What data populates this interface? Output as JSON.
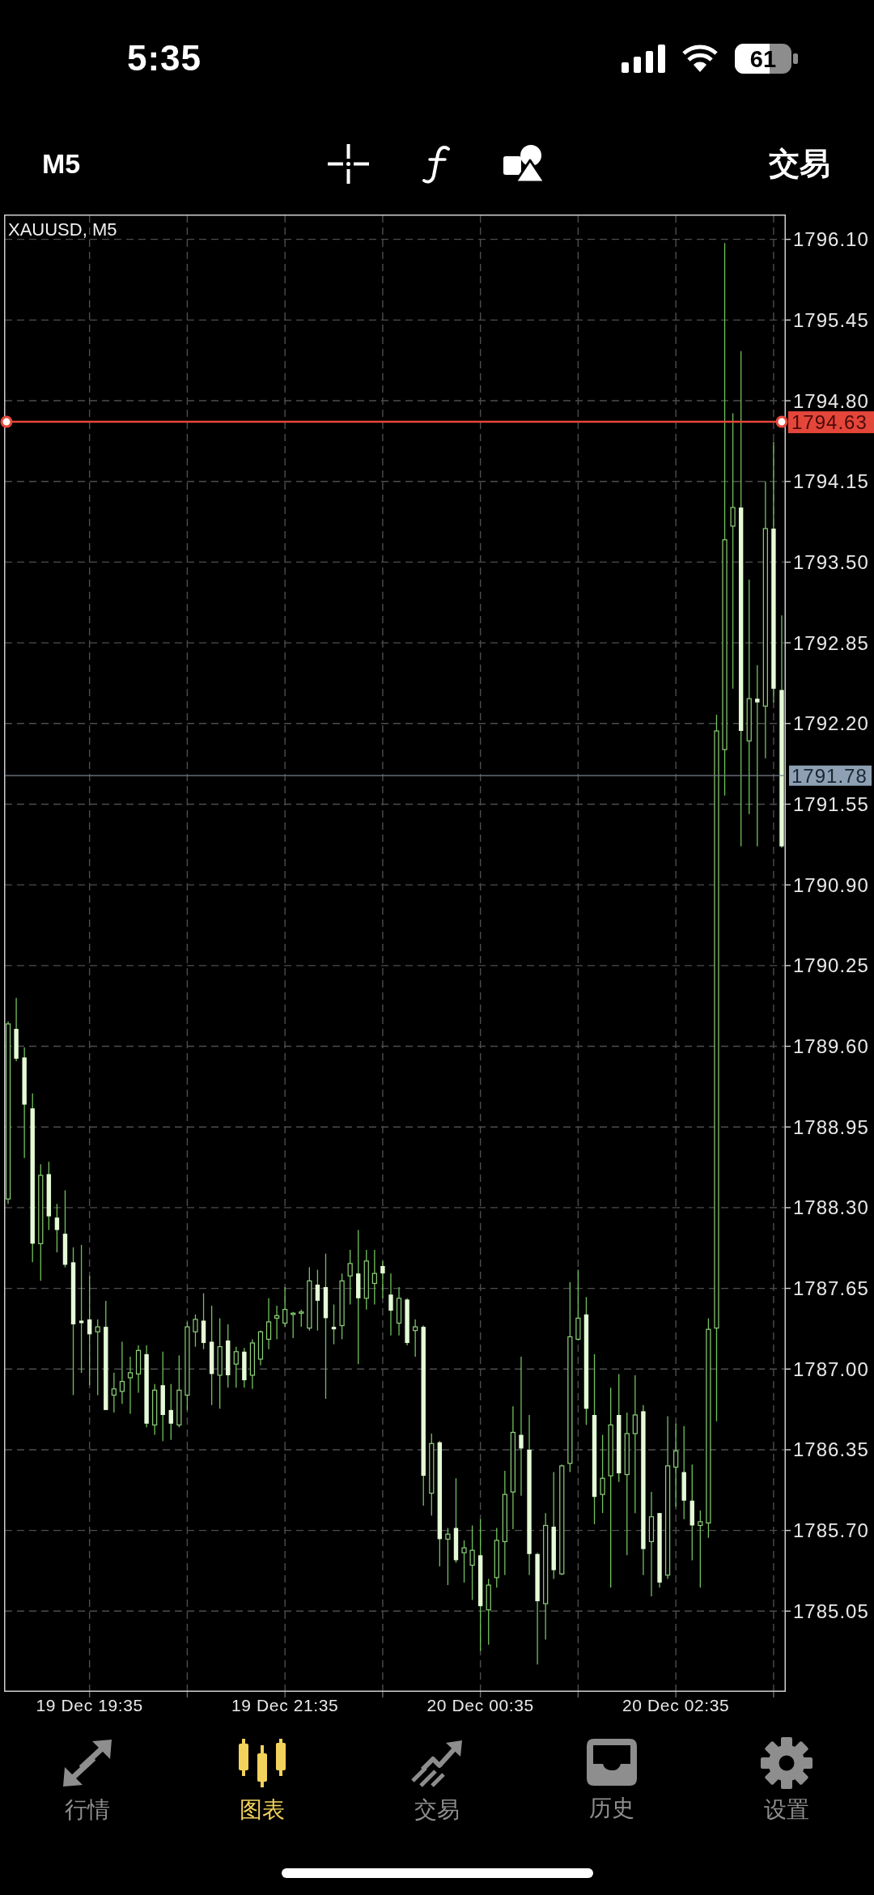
{
  "status_bar": {
    "time": "5:35",
    "battery": "61"
  },
  "toolbar": {
    "timeframe": "M5",
    "trade": "交易"
  },
  "chart": {
    "chart_data": {
      "type": "candlestick",
      "title": "XAUUSD, M5",
      "grid": true,
      "categories": [
        null,
        null,
        null,
        null,
        null,
        null,
        null,
        null,
        null,
        null,
        "19 Dec 19:35",
        null,
        null,
        null,
        null,
        null,
        null,
        null,
        null,
        null,
        null,
        null,
        null,
        null,
        null,
        null,
        null,
        null,
        null,
        null,
        null,
        null,
        null,
        null,
        "19 Dec 21:35",
        null,
        null,
        null,
        null,
        null,
        null,
        null,
        null,
        null,
        null,
        null,
        null,
        null,
        null,
        null,
        null,
        null,
        null,
        null,
        null,
        null,
        null,
        null,
        "20 Dec 00:35",
        null,
        null,
        null,
        null,
        null,
        null,
        null,
        null,
        null,
        null,
        null,
        null,
        null,
        null,
        null,
        null,
        null,
        null,
        null,
        null,
        null,
        null,
        null,
        "20 Dec 02:35",
        null,
        null,
        null,
        null,
        null,
        null,
        null,
        null,
        null,
        null,
        null,
        null,
        null
      ],
      "ohlc": [
        [
          1788.37,
          1789.8,
          1788.33,
          1789.78
        ],
        [
          1789.74,
          1789.99,
          1789.48,
          1789.5
        ],
        [
          1789.51,
          1789.59,
          1788.7,
          1789.13
        ],
        [
          1789.1,
          1789.22,
          1787.86,
          1788.01
        ],
        [
          1788.01,
          1788.65,
          1787.71,
          1788.56
        ],
        [
          1788.57,
          1788.67,
          1788.12,
          1788.23
        ],
        [
          1788.22,
          1788.33,
          1787.94,
          1788.12
        ],
        [
          1788.09,
          1788.44,
          1787.82,
          1787.84
        ],
        [
          1787.86,
          1787.98,
          1786.79,
          1787.36
        ],
        [
          1787.39,
          1788.0,
          1786.97,
          1787.37
        ],
        [
          1787.4,
          1787.75,
          1786.87,
          1787.28
        ],
        [
          1787.3,
          1787.4,
          1786.79,
          1787.34
        ],
        [
          1787.34,
          1787.55,
          1786.67,
          1786.67
        ],
        [
          1786.79,
          1786.97,
          1786.65,
          1786.84
        ],
        [
          1786.82,
          1787.22,
          1786.72,
          1786.9
        ],
        [
          1786.93,
          1787.1,
          1786.64,
          1786.97
        ],
        [
          1786.96,
          1787.19,
          1786.81,
          1787.15
        ],
        [
          1787.12,
          1787.19,
          1786.53,
          1786.56
        ],
        [
          1786.55,
          1786.88,
          1786.47,
          1786.83
        ],
        [
          1786.87,
          1787.14,
          1786.42,
          1786.63
        ],
        [
          1786.67,
          1786.88,
          1786.43,
          1786.56
        ],
        [
          1786.55,
          1787.11,
          1786.53,
          1786.83
        ],
        [
          1786.79,
          1787.38,
          1786.67,
          1787.34
        ],
        [
          1787.3,
          1787.44,
          1787.18,
          1787.4
        ],
        [
          1787.39,
          1787.61,
          1787.16,
          1787.21
        ],
        [
          1787.22,
          1787.51,
          1786.71,
          1786.96
        ],
        [
          1786.95,
          1787.41,
          1786.68,
          1787.18
        ],
        [
          1787.23,
          1787.36,
          1786.85,
          1786.95
        ],
        [
          1787.04,
          1787.18,
          1786.85,
          1787.14
        ],
        [
          1787.14,
          1787.17,
          1786.85,
          1786.91
        ],
        [
          1786.95,
          1787.24,
          1786.84,
          1787.21
        ],
        [
          1787.08,
          1787.31,
          1787.03,
          1787.3
        ],
        [
          1787.24,
          1787.57,
          1787.16,
          1787.38
        ],
        [
          1787.41,
          1787.51,
          1787.24,
          1787.43
        ],
        [
          1787.37,
          1787.66,
          1787.34,
          1787.48
        ],
        [
          1787.44,
          1787.46,
          1787.25,
          1787.45
        ],
        [
          1787.45,
          1787.48,
          1787.34,
          1787.46
        ],
        [
          1787.33,
          1787.82,
          1787.31,
          1787.71
        ],
        [
          1787.68,
          1787.8,
          1787.31,
          1787.55
        ],
        [
          1787.66,
          1787.93,
          1786.76,
          1787.41
        ],
        [
          1787.34,
          1787.52,
          1787.2,
          1787.32
        ],
        [
          1787.35,
          1787.77,
          1787.24,
          1787.71
        ],
        [
          1787.75,
          1787.96,
          1787.52,
          1787.85
        ],
        [
          1787.77,
          1788.12,
          1787.04,
          1787.57
        ],
        [
          1787.57,
          1787.96,
          1787.48,
          1787.87
        ],
        [
          1787.69,
          1787.96,
          1787.52,
          1787.77
        ],
        [
          1787.83,
          1787.87,
          1787.57,
          1787.77
        ],
        [
          1787.6,
          1787.77,
          1787.27,
          1787.47
        ],
        [
          1787.37,
          1787.66,
          1787.27,
          1787.57
        ],
        [
          1787.56,
          1787.57,
          1787.19,
          1787.21
        ],
        [
          1787.31,
          1787.4,
          1787.1,
          1787.34
        ],
        [
          1787.34,
          1787.35,
          1785.9,
          1786.14
        ],
        [
          1786.0,
          1786.48,
          1785.82,
          1786.4
        ],
        [
          1786.41,
          1786.42,
          1785.41,
          1785.63
        ],
        [
          1785.63,
          1785.72,
          1785.26,
          1785.67
        ],
        [
          1785.72,
          1786.12,
          1785.44,
          1785.46
        ],
        [
          1785.52,
          1785.62,
          1785.28,
          1785.56
        ],
        [
          1785.42,
          1785.74,
          1785.14,
          1785.54
        ],
        [
          1785.5,
          1785.79,
          1784.73,
          1785.09
        ],
        [
          1785.06,
          1785.31,
          1784.78,
          1785.26
        ],
        [
          1785.32,
          1785.72,
          1785.24,
          1785.62
        ],
        [
          1785.61,
          1786.18,
          1785.34,
          1785.99
        ],
        [
          1786.01,
          1786.7,
          1785.71,
          1786.49
        ],
        [
          1786.47,
          1787.1,
          1785.98,
          1786.36
        ],
        [
          1786.35,
          1786.63,
          1785.34,
          1785.51
        ],
        [
          1785.51,
          1785.52,
          1784.62,
          1785.13
        ],
        [
          1785.11,
          1785.84,
          1784.82,
          1785.74
        ],
        [
          1785.73,
          1786.17,
          1785.31,
          1785.38
        ],
        [
          1785.35,
          1786.23,
          1785.34,
          1786.22
        ],
        [
          1786.24,
          1787.7,
          1786.17,
          1787.26
        ],
        [
          1787.24,
          1787.8,
          1787.23,
          1787.41
        ],
        [
          1787.44,
          1787.58,
          1786.55,
          1786.68
        ],
        [
          1786.63,
          1787.12,
          1785.75,
          1785.97
        ],
        [
          1785.99,
          1786.47,
          1785.84,
          1786.12
        ],
        [
          1786.14,
          1786.85,
          1785.24,
          1786.55
        ],
        [
          1786.63,
          1786.96,
          1786.09,
          1786.16
        ],
        [
          1786.15,
          1786.65,
          1785.5,
          1786.48
        ],
        [
          1786.48,
          1786.95,
          1785.84,
          1786.63
        ],
        [
          1786.66,
          1786.71,
          1785.34,
          1785.55
        ],
        [
          1785.61,
          1786.01,
          1785.17,
          1785.81
        ],
        [
          1785.84,
          1785.84,
          1785.24,
          1785.28
        ],
        [
          1785.34,
          1786.62,
          1785.31,
          1786.22
        ],
        [
          1786.21,
          1786.56,
          1785.89,
          1786.34
        ],
        [
          1786.17,
          1786.54,
          1785.79,
          1785.94
        ],
        [
          1785.94,
          1786.23,
          1785.46,
          1785.74
        ],
        [
          1785.74,
          1785.86,
          1785.24,
          1785.77
        ],
        [
          1785.76,
          1787.41,
          1785.64,
          1787.32
        ],
        [
          1787.33,
          1792.27,
          1786.58,
          1792.14
        ],
        [
          1791.99,
          1796.07,
          1791.62,
          1793.68
        ],
        [
          1793.79,
          1794.7,
          1792.48,
          1793.94
        ],
        [
          1793.94,
          1795.2,
          1791.21,
          1792.14
        ],
        [
          1792.06,
          1793.36,
          1791.47,
          1792.4
        ],
        [
          1792.4,
          1792.67,
          1791.21,
          1792.37
        ],
        [
          1792.34,
          1794.15,
          1791.92,
          1793.77
        ],
        [
          1793.77,
          1794.47,
          1792.37,
          1792.48
        ],
        [
          1792.47,
          1793.07,
          1791.2,
          1791.21
        ]
      ],
      "ylim": [
        1784.4,
        1796.3
      ],
      "yticks": [
        {
          "value": 1796.1,
          "label": "1796.10"
        },
        {
          "value": 1795.45,
          "label": "1795.45"
        },
        {
          "value": 1794.8,
          "label": "1794.80"
        },
        {
          "value": 1794.15,
          "label": "1794.15"
        },
        {
          "value": 1793.5,
          "label": "1793.50"
        },
        {
          "value": 1792.85,
          "label": "1792.85"
        },
        {
          "value": 1792.2,
          "label": "1792.20"
        },
        {
          "value": 1791.55,
          "label": "1791.55"
        },
        {
          "value": 1790.9,
          "label": "1790.90"
        },
        {
          "value": 1790.25,
          "label": "1790.25"
        },
        {
          "value": 1789.6,
          "label": "1789.60"
        },
        {
          "value": 1788.95,
          "label": "1788.95"
        },
        {
          "value": 1788.3,
          "label": "1788.30"
        },
        {
          "value": 1787.65,
          "label": "1787.65"
        },
        {
          "value": 1787.0,
          "label": "1787.00"
        },
        {
          "value": 1786.35,
          "label": "1786.35"
        },
        {
          "value": 1785.7,
          "label": "1785.70"
        },
        {
          "value": 1785.05,
          "label": "1785.05"
        }
      ],
      "ref_lines": [
        {
          "axis": "y",
          "value": 1794.63,
          "label": "1794.63",
          "color": "#e5463a"
        },
        {
          "axis": "y",
          "value": 1791.78,
          "label": "1791.78",
          "color": "#76808c"
        }
      ]
    },
    "price_lines": [
      {
        "kind": "level"
      },
      {
        "kind": "bid"
      }
    ]
  },
  "tab_bar": [
    {
      "label": "行情",
      "selected": false
    },
    {
      "label": "图表",
      "selected": true
    },
    {
      "label": "交易",
      "selected": false
    },
    {
      "label": "历史",
      "selected": false
    },
    {
      "label": "设置",
      "selected": false
    }
  ]
}
